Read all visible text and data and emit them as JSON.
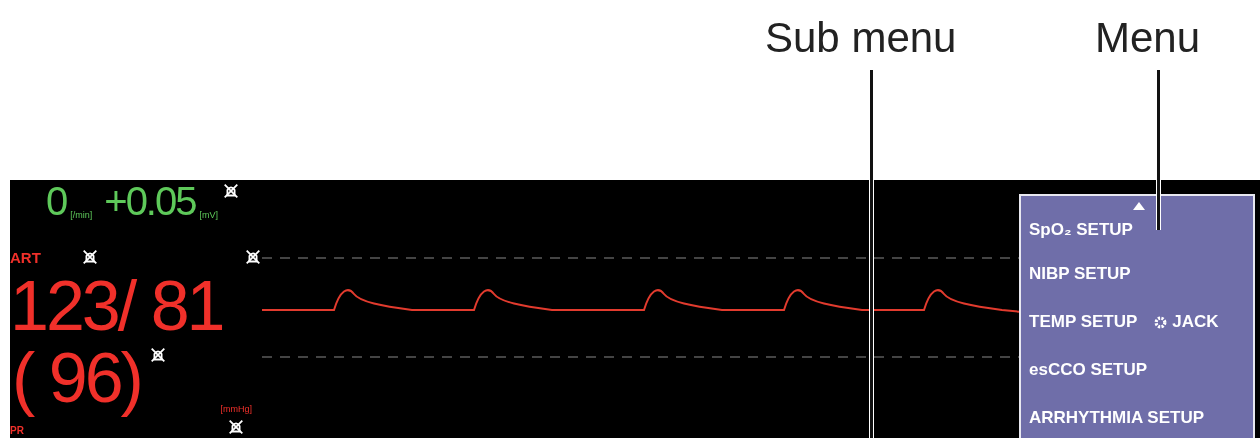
{
  "annotations": [
    {
      "label": "Sub menu"
    },
    {
      "label": "Menu"
    }
  ],
  "st": {
    "value_1": "0",
    "unit_1": "[/min]",
    "value_2": "+0.05",
    "unit_2": "[mV]"
  },
  "art": {
    "label": "ART",
    "value": "123/ 81",
    "mean": "( 96)",
    "unit": "[mmHg]"
  },
  "pr": {
    "label": "PR"
  },
  "menu": {
    "items": [
      {
        "label": "SpO₂ SETUP"
      },
      {
        "label": "NIBP SETUP"
      },
      {
        "label": "TEMP SETUP",
        "option": "JACK"
      },
      {
        "label": "esCCO SETUP"
      },
      {
        "label": "ARRHYTHMIA SETUP"
      }
    ]
  }
}
